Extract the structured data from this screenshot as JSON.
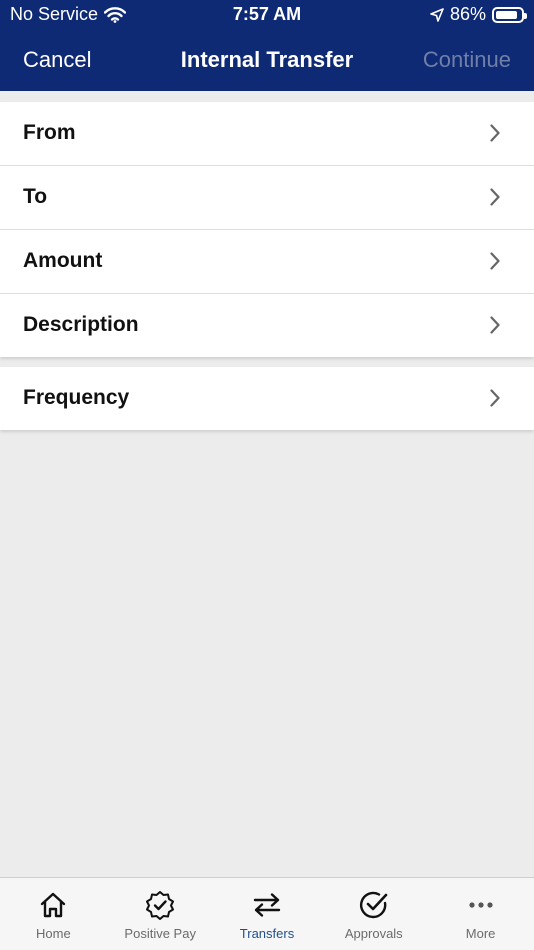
{
  "status_bar": {
    "carrier": "No Service",
    "time": "7:57 AM",
    "battery_percent": "86%",
    "battery_level": 0.86
  },
  "nav": {
    "cancel_label": "Cancel",
    "title": "Internal Transfer",
    "continue_label": "Continue"
  },
  "form": {
    "section_one": [
      {
        "label": "From"
      },
      {
        "label": "To"
      },
      {
        "label": "Amount"
      },
      {
        "label": "Description"
      }
    ],
    "section_two": [
      {
        "label": "Frequency"
      }
    ]
  },
  "tab_bar": {
    "tabs": [
      {
        "label": "Home",
        "icon": "home-icon"
      },
      {
        "label": "Positive Pay",
        "icon": "badge-check-icon"
      },
      {
        "label": "Transfers",
        "icon": "transfer-arrows-icon",
        "active": true
      },
      {
        "label": "Approvals",
        "icon": "check-circle-icon"
      },
      {
        "label": "More",
        "icon": "more-dots-icon"
      }
    ]
  },
  "colors": {
    "header_bg": "#0f2a74",
    "active_tab": "#1f4f8c",
    "disabled_nav": "#6f7fa8",
    "background": "#ececec"
  }
}
